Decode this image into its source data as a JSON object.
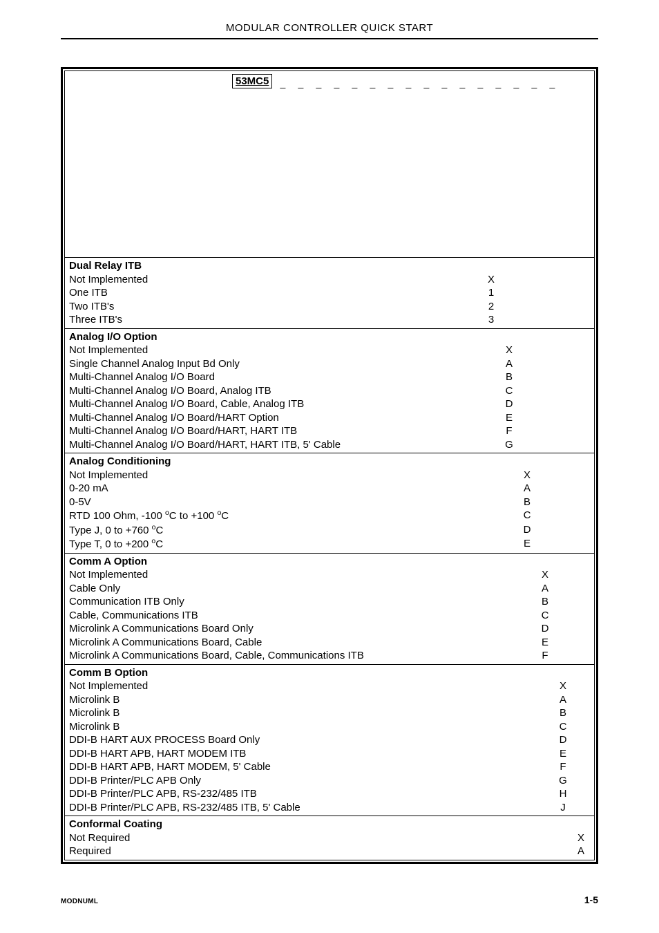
{
  "header": {
    "title": "MODULAR CONTROLLER QUICK START"
  },
  "model": {
    "label": "53MC5"
  },
  "columns": 6,
  "sections": [
    {
      "title": "Dual Relay ITB",
      "col": 0,
      "rows": [
        {
          "label": "Not Implemented",
          "code": "X"
        },
        {
          "label": "One ITB",
          "code": "1"
        },
        {
          "label": "Two ITB's",
          "code": "2"
        },
        {
          "label": "Three ITB's",
          "code": "3"
        }
      ]
    },
    {
      "title": "Analog I/O Option",
      "col": 1,
      "rows": [
        {
          "label": "Not Implemented",
          "code": "X"
        },
        {
          "label": "Single Channel Analog Input Bd Only",
          "code": "A"
        },
        {
          "label": "Multi-Channel Analog I/O Board",
          "code": "B"
        },
        {
          "label": "Multi-Channel Analog I/O Board, Analog ITB",
          "code": "C"
        },
        {
          "label": "Multi-Channel Analog I/O Board, Cable, Analog ITB",
          "code": "D"
        },
        {
          "label": "Multi-Channel Analog I/O Board/HART Option",
          "code": "E"
        },
        {
          "label": "Multi-Channel Analog I/O Board/HART, HART ITB",
          "code": "F"
        },
        {
          "label": "Multi-Channel Analog I/O Board/HART, HART ITB, 5' Cable",
          "code": "G"
        }
      ]
    },
    {
      "title": "Analog Conditioning",
      "col": 2,
      "rows": [
        {
          "label": "Not Implemented",
          "code": "X"
        },
        {
          "label": "0-20 mA",
          "code": "A"
        },
        {
          "label": "0-5V",
          "code": "B"
        },
        {
          "label_html": "RTD 100 Ohm, -100 <sup class='deg'>o</sup>C to +100 <sup class='deg'>o</sup>C",
          "code": "C"
        },
        {
          "label_html": "Type J, 0 to +760 <sup class='deg'>o</sup>C",
          "code": "D"
        },
        {
          "label_html": "Type T, 0 to +200 <sup class='deg'>o</sup>C",
          "code": "E"
        }
      ]
    },
    {
      "title": "Comm A Option",
      "col": 3,
      "rows": [
        {
          "label": "Not Implemented",
          "code": "X"
        },
        {
          "label": "Cable Only",
          "code": "A"
        },
        {
          "label": "Communication ITB Only",
          "code": "B"
        },
        {
          "label": "Cable, Communications ITB",
          "code": "C"
        },
        {
          "label": "Microlink A Communications Board Only",
          "code": "D"
        },
        {
          "label": "Microlink A Communications Board, Cable",
          "code": "E"
        },
        {
          "label": "Microlink A Communications Board, Cable, Communications ITB",
          "code": "F"
        }
      ]
    },
    {
      "title": "Comm B Option",
      "col": 4,
      "rows": [
        {
          "label": "Not Implemented",
          "code": "X"
        },
        {
          "label": "Microlink B",
          "code": "A"
        },
        {
          "label": "Microlink B",
          "code": "B"
        },
        {
          "label": "Microlink B",
          "code": "C"
        },
        {
          "label": "DDI-B HART AUX PROCESS Board Only",
          "code": "D"
        },
        {
          "label": "DDI-B HART APB, HART MODEM ITB",
          "code": "E"
        },
        {
          "label": "DDI-B HART APB, HART MODEM, 5' Cable",
          "code": "F"
        },
        {
          "label": "DDI-B Printer/PLC APB Only",
          "code": "G"
        },
        {
          "label": "DDI-B Printer/PLC APB, RS-232/485 ITB",
          "code": "H"
        },
        {
          "label": "DDI-B Printer/PLC APB, RS-232/485 ITB, 5' Cable",
          "code": "J"
        }
      ]
    },
    {
      "title": "Conformal Coating",
      "col": 5,
      "rows": [
        {
          "label": "Not Required",
          "code": "X"
        },
        {
          "label": "Required",
          "code": "A"
        }
      ]
    }
  ],
  "footer": {
    "left": "MODNUML",
    "right": "1-5"
  }
}
